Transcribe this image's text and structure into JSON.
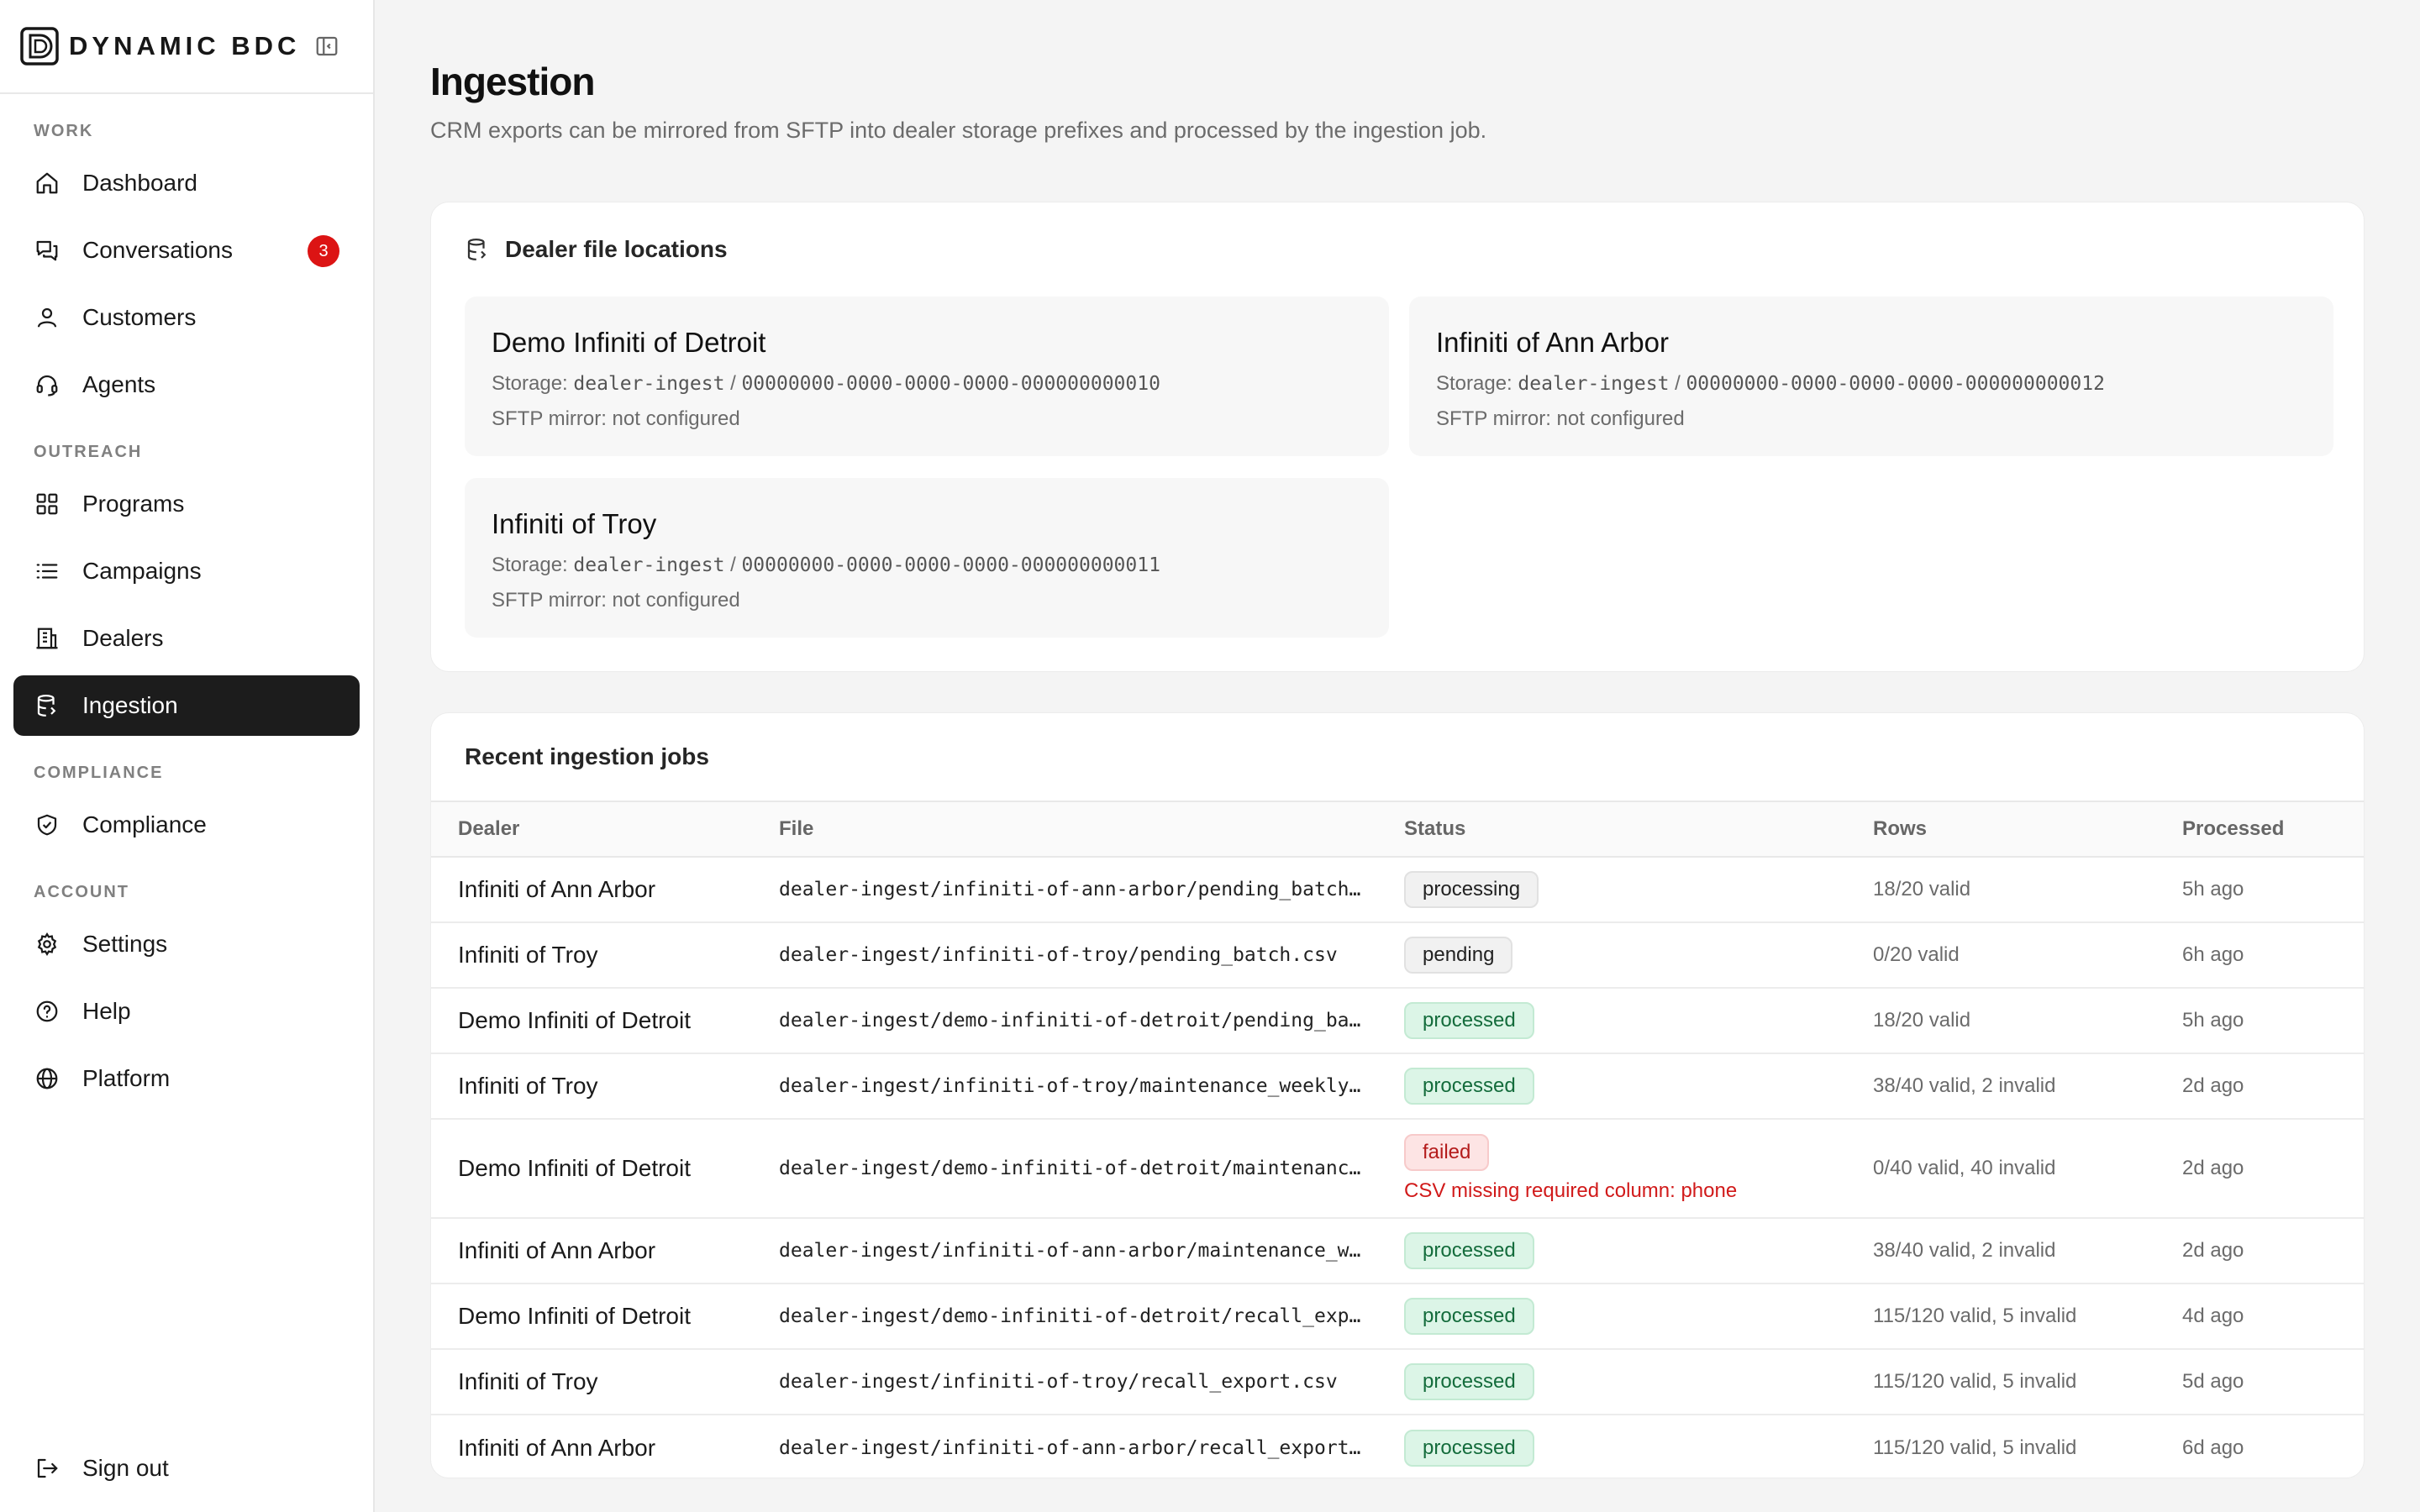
{
  "brand": {
    "name": "DYNAMIC BDC"
  },
  "nav": {
    "sections": [
      {
        "label": "WORK",
        "items": [
          {
            "label": "Dashboard",
            "icon": "home-icon"
          },
          {
            "label": "Conversations",
            "icon": "chat-icon",
            "badge": "3"
          },
          {
            "label": "Customers",
            "icon": "user-icon"
          },
          {
            "label": "Agents",
            "icon": "headset-icon"
          }
        ]
      },
      {
        "label": "OUTREACH",
        "items": [
          {
            "label": "Programs",
            "icon": "grid-icon"
          },
          {
            "label": "Campaigns",
            "icon": "list-icon"
          },
          {
            "label": "Dealers",
            "icon": "building-icon"
          },
          {
            "label": "Ingestion",
            "icon": "database-icon",
            "active": true
          }
        ]
      },
      {
        "label": "COMPLIANCE",
        "items": [
          {
            "label": "Compliance",
            "icon": "shield-check-icon"
          }
        ]
      },
      {
        "label": "ACCOUNT",
        "items": [
          {
            "label": "Settings",
            "icon": "gear-icon"
          },
          {
            "label": "Help",
            "icon": "help-circle-icon"
          },
          {
            "label": "Platform",
            "icon": "globe-icon"
          }
        ]
      }
    ],
    "sign_out": "Sign out"
  },
  "page": {
    "title": "Ingestion",
    "subtitle": "CRM exports can be mirrored from SFTP into dealer storage prefixes and processed by the ingestion job."
  },
  "locations": {
    "title": "Dealer file locations",
    "storage_label": "Storage:",
    "items": [
      {
        "name": "Demo Infiniti of Detroit",
        "bucket": "dealer-ingest",
        "prefix": "00000000-0000-0000-0000-000000000010",
        "sftp": "SFTP mirror: not configured"
      },
      {
        "name": "Infiniti of Ann Arbor",
        "bucket": "dealer-ingest",
        "prefix": "00000000-0000-0000-0000-000000000012",
        "sftp": "SFTP mirror: not configured"
      },
      {
        "name": "Infiniti of Troy",
        "bucket": "dealer-ingest",
        "prefix": "00000000-0000-0000-0000-000000000011",
        "sftp": "SFTP mirror: not configured"
      }
    ]
  },
  "jobs": {
    "title": "Recent ingestion jobs",
    "columns": {
      "dealer": "Dealer",
      "file": "File",
      "status": "Status",
      "rows": "Rows",
      "processed": "Processed"
    },
    "rows": [
      {
        "dealer": "Infiniti of Ann Arbor",
        "file": "dealer-ingest/infiniti-of-ann-arbor/pending_batch.csv",
        "status": "processing",
        "rows": "18/20 valid",
        "processed": "5h ago"
      },
      {
        "dealer": "Infiniti of Troy",
        "file": "dealer-ingest/infiniti-of-troy/pending_batch.csv",
        "status": "pending",
        "rows": "0/20 valid",
        "processed": "6h ago"
      },
      {
        "dealer": "Demo Infiniti of Detroit",
        "file": "dealer-ingest/demo-infiniti-of-detroit/pending_batch.csv",
        "status": "processed",
        "rows": "18/20 valid",
        "processed": "5h ago"
      },
      {
        "dealer": "Infiniti of Troy",
        "file": "dealer-ingest/infiniti-of-troy/maintenance_weekly.csv",
        "status": "processed",
        "rows": "38/40 valid, 2 invalid",
        "processed": "2d ago"
      },
      {
        "dealer": "Demo Infiniti of Detroit",
        "file": "dealer-ingest/demo-infiniti-of-detroit/maintenance_weekly.csv",
        "status": "failed",
        "error": "CSV missing required column: phone",
        "rows": "0/40 valid, 40 invalid",
        "processed": "2d ago"
      },
      {
        "dealer": "Infiniti of Ann Arbor",
        "file": "dealer-ingest/infiniti-of-ann-arbor/maintenance_weekly.csv",
        "status": "processed",
        "rows": "38/40 valid, 2 invalid",
        "processed": "2d ago"
      },
      {
        "dealer": "Demo Infiniti of Detroit",
        "file": "dealer-ingest/demo-infiniti-of-detroit/recall_export.csv",
        "status": "processed",
        "rows": "115/120 valid, 5 invalid",
        "processed": "4d ago"
      },
      {
        "dealer": "Infiniti of Troy",
        "file": "dealer-ingest/infiniti-of-troy/recall_export.csv",
        "status": "processed",
        "rows": "115/120 valid, 5 invalid",
        "processed": "5d ago"
      },
      {
        "dealer": "Infiniti of Ann Arbor",
        "file": "dealer-ingest/infiniti-of-ann-arbor/recall_export.csv",
        "status": "processed",
        "rows": "115/120 valid, 5 invalid",
        "processed": "6d ago"
      }
    ]
  }
}
